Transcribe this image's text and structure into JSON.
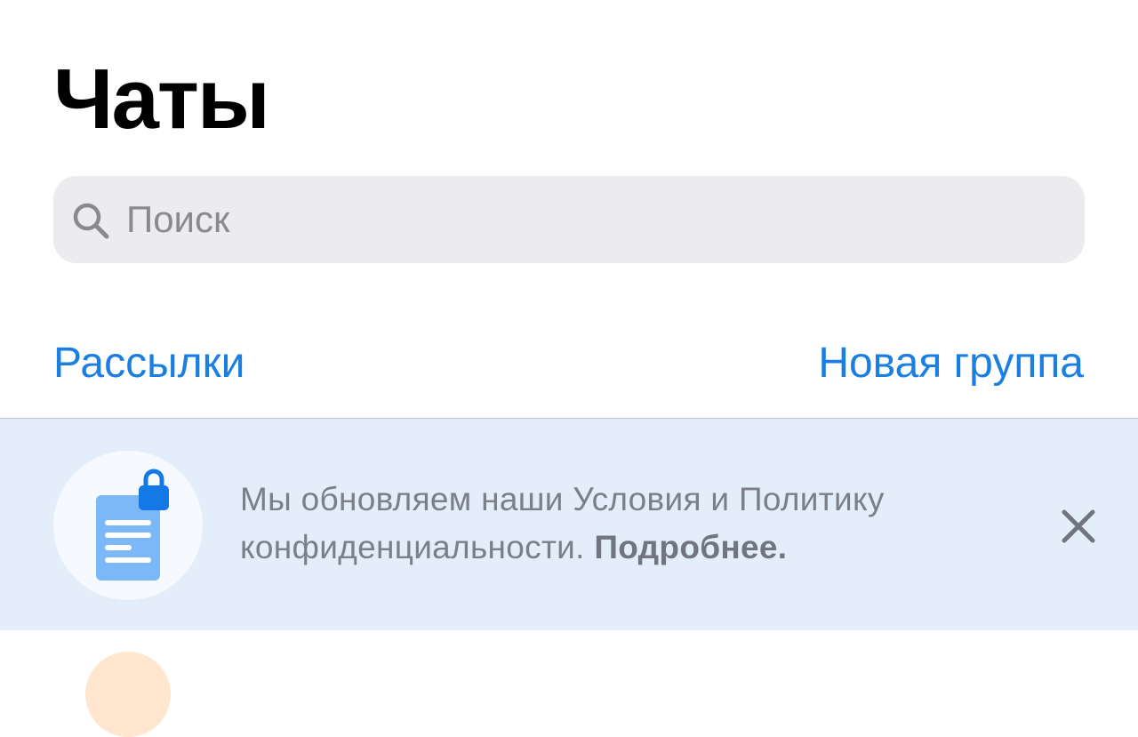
{
  "header": {
    "title": "Чаты"
  },
  "search": {
    "placeholder": "Поиск",
    "icon": "search-icon"
  },
  "actions": {
    "broadcasts_label": "Рассылки",
    "new_group_label": "Новая группа"
  },
  "banner": {
    "icon": "document-lock-icon",
    "text": "Мы обновляем наши Условия и Политику конфиденциальности.",
    "link_label": "Подробнее.",
    "close_icon": "close-icon"
  },
  "colors": {
    "accent": "#1b7fe1",
    "banner_bg": "#e4eefb",
    "search_bg": "#ececee"
  }
}
